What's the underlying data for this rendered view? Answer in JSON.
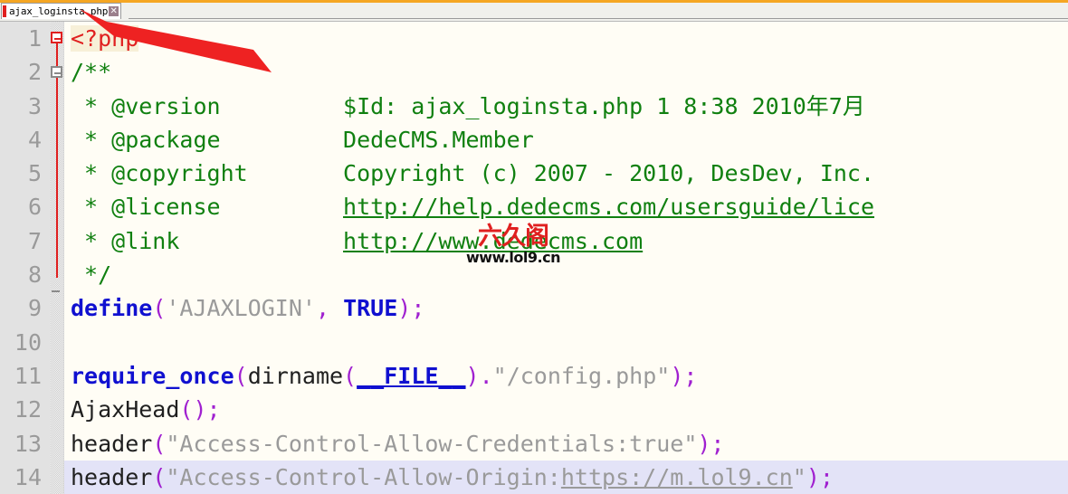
{
  "window": {
    "accent_color": "#f5a623",
    "editor_background": "#fffdf5",
    "gutter_background": "#e2e2e2",
    "current_line_highlight": "#e3e3f7"
  },
  "tabbar": {
    "tabs": [
      {
        "label": "ajax_loginsta.php",
        "close_label": "✕",
        "modified_marker": true
      }
    ]
  },
  "editor": {
    "language": "PHP",
    "current_line": 14,
    "fold_markers": [
      {
        "line": 1,
        "state": "expanded",
        "color": "#e02020",
        "glyph": "−"
      },
      {
        "line": 2,
        "state": "expanded",
        "color": "#8a8a8a",
        "glyph": "−"
      }
    ],
    "lines": [
      {
        "number": "1",
        "highlighted": false,
        "tokens": [
          {
            "text": "<?php",
            "style": "t-php"
          }
        ]
      },
      {
        "number": "2",
        "highlighted": false,
        "tokens": [
          {
            "text": "/**",
            "style": "t-cmt"
          }
        ]
      },
      {
        "number": "3",
        "highlighted": false,
        "tokens": [
          {
            "text": " * @version         $Id: ajax_loginsta.php 1 8:38 2010年7月",
            "style": "t-cmt"
          }
        ]
      },
      {
        "number": "4",
        "highlighted": false,
        "tokens": [
          {
            "text": " * @package         DedeCMS.Member",
            "style": "t-cmt"
          }
        ]
      },
      {
        "number": "5",
        "highlighted": false,
        "tokens": [
          {
            "text": " * @copyright       Copyright (c) 2007 - 2010, DesDev, Inc.",
            "style": "t-cmt"
          }
        ]
      },
      {
        "number": "6",
        "highlighted": false,
        "tokens": [
          {
            "text": " * @license         ",
            "style": "t-cmt"
          },
          {
            "text": "http://help.dedecms.com/usersguide/lice",
            "style": "t-cmtlink"
          }
        ]
      },
      {
        "number": "7",
        "highlighted": false,
        "tokens": [
          {
            "text": " * @link            ",
            "style": "t-cmt"
          },
          {
            "text": "http://www.dedecms.com",
            "style": "t-cmtlink"
          }
        ]
      },
      {
        "number": "8",
        "highlighted": false,
        "tokens": [
          {
            "text": " */",
            "style": "t-cmt"
          }
        ]
      },
      {
        "number": "9",
        "highlighted": false,
        "tokens": [
          {
            "text": "define",
            "style": "t-kw"
          },
          {
            "text": "(",
            "style": "t-punct"
          },
          {
            "text": "'AJAXLOGIN'",
            "style": "t-str"
          },
          {
            "text": ",",
            "style": "t-punct"
          },
          {
            "text": " ",
            "style": "t-plain"
          },
          {
            "text": "TRUE",
            "style": "t-kw"
          },
          {
            "text": ");",
            "style": "t-punct"
          }
        ]
      },
      {
        "number": "10",
        "highlighted": false,
        "tokens": []
      },
      {
        "number": "11",
        "highlighted": false,
        "tokens": [
          {
            "text": "require_once",
            "style": "t-kw"
          },
          {
            "text": "(",
            "style": "t-punct"
          },
          {
            "text": "dirname",
            "style": "t-plain"
          },
          {
            "text": "(",
            "style": "t-punct"
          },
          {
            "text": "__FILE__",
            "style": "t-const"
          },
          {
            "text": ")",
            "style": "t-punct"
          },
          {
            "text": ".",
            "style": "t-punct"
          },
          {
            "text": "\"/config.php\"",
            "style": "t-str"
          },
          {
            "text": ");",
            "style": "t-punct"
          }
        ]
      },
      {
        "number": "12",
        "highlighted": false,
        "tokens": [
          {
            "text": "AjaxHead",
            "style": "t-plain"
          },
          {
            "text": "();",
            "style": "t-punct"
          }
        ]
      },
      {
        "number": "13",
        "highlighted": false,
        "tokens": [
          {
            "text": "header",
            "style": "t-plain"
          },
          {
            "text": "(",
            "style": "t-punct"
          },
          {
            "text": "\"Access-Control-Allow-Credentials:true\"",
            "style": "t-str"
          },
          {
            "text": ");",
            "style": "t-punct"
          }
        ]
      },
      {
        "number": "14",
        "highlighted": true,
        "tokens": [
          {
            "text": "header",
            "style": "t-plain"
          },
          {
            "text": "(",
            "style": "t-punct"
          },
          {
            "text": "\"Access-Control-Allow-Origin:",
            "style": "t-str"
          },
          {
            "text": "https://m.lol9.cn",
            "style": "t-link"
          },
          {
            "text": "\"",
            "style": "t-str"
          },
          {
            "text": ");",
            "style": "t-punct"
          }
        ]
      }
    ]
  },
  "watermark": {
    "cn_text": "六久阁",
    "en_text": "www.lol9.cn",
    "cn_color": "#e02020",
    "en_color": "#111111"
  },
  "annotation": {
    "type": "arrow",
    "color": "#ee2222",
    "points_to": "tab-close-button"
  }
}
